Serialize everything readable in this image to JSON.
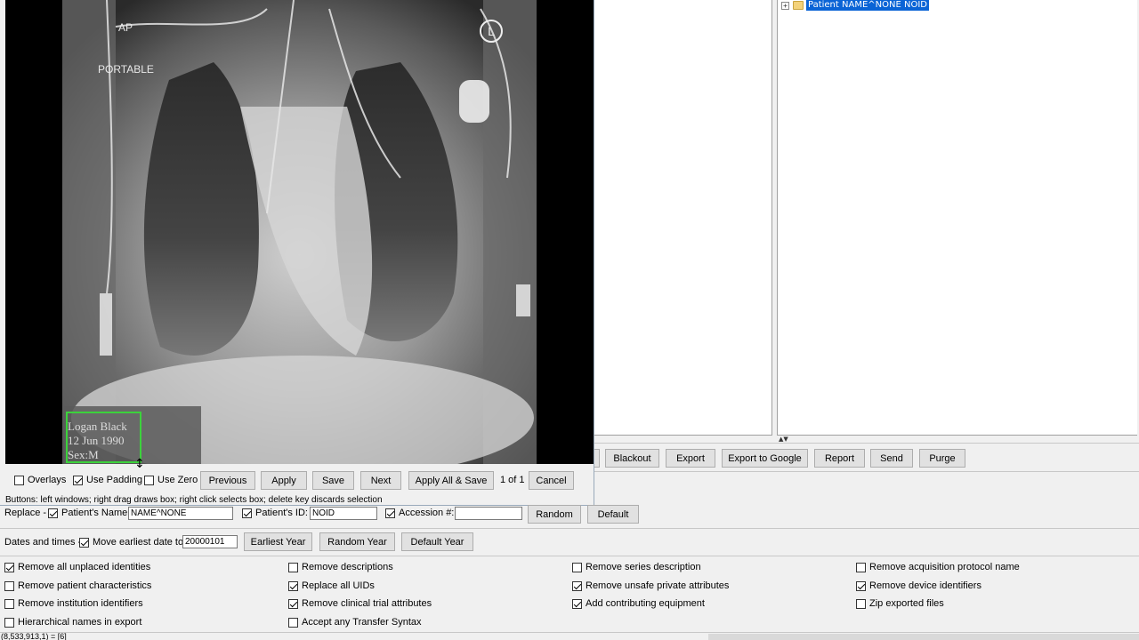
{
  "tree": {
    "patient_node": "Patient NAME^NONE NOID",
    "expander": "+"
  },
  "toolbar": {
    "blackout": "Blackout",
    "export": "Export",
    "export_google": "Export to Google",
    "report": "Report",
    "send": "Send",
    "purge": "Purge"
  },
  "viewer": {
    "overlay_ap": "AP",
    "overlay_portable": "PORTABLE",
    "marker": "L",
    "phi_name": "Logan Black",
    "phi_date": "12 Jun 1990",
    "phi_sex": "Sex:M",
    "overlays_label": "Overlays",
    "use_padding_label": "Use Padding",
    "use_zero_label": "Use Zero",
    "previous": "Previous",
    "apply": "Apply",
    "save": "Save",
    "next": "Next",
    "apply_all_save": "Apply All & Save",
    "page_count": "1 of 1",
    "cancel": "Cancel",
    "status": "Buttons: left windows; right drag draws box; right click selects box; delete key discards selection",
    "checks": {
      "overlays": false,
      "use_padding": true,
      "use_zero": false
    }
  },
  "replace": {
    "label": "Replace -",
    "patient_name_label": "Patient's Name:",
    "patient_name_value": "NAME^NONE",
    "patient_id_label": "Patient's ID:",
    "patient_id_value": "NOID",
    "accession_label": "Accession #:",
    "accession_value": "",
    "random": "Random",
    "default": "Default"
  },
  "dates": {
    "label": "Dates and times -",
    "move_label": "Move earliest date to:",
    "move_value": "20000101",
    "earliest_year": "Earliest Year",
    "random_year": "Random Year",
    "default_year": "Default Year"
  },
  "options": [
    {
      "label": "Remove all unplaced identities",
      "checked": true
    },
    {
      "label": "Remove descriptions",
      "checked": false
    },
    {
      "label": "Remove series description",
      "checked": false
    },
    {
      "label": "Remove acquisition protocol name",
      "checked": false
    },
    {
      "label": "Remove patient characteristics",
      "checked": false
    },
    {
      "label": "Replace all UIDs",
      "checked": true
    },
    {
      "label": "Remove unsafe private attributes",
      "checked": true
    },
    {
      "label": "Remove device identifiers",
      "checked": true
    },
    {
      "label": "Remove institution identifiers",
      "checked": false
    },
    {
      "label": "Remove clinical trial attributes",
      "checked": true
    },
    {
      "label": "Add contributing equipment",
      "checked": true
    },
    {
      "label": "Zip exported files",
      "checked": false
    },
    {
      "label": "Hierarchical names in export",
      "checked": false
    },
    {
      "label": "Accept any Transfer Syntax",
      "checked": false
    }
  ],
  "status_bar": "(8,533,913,1) = [6]"
}
